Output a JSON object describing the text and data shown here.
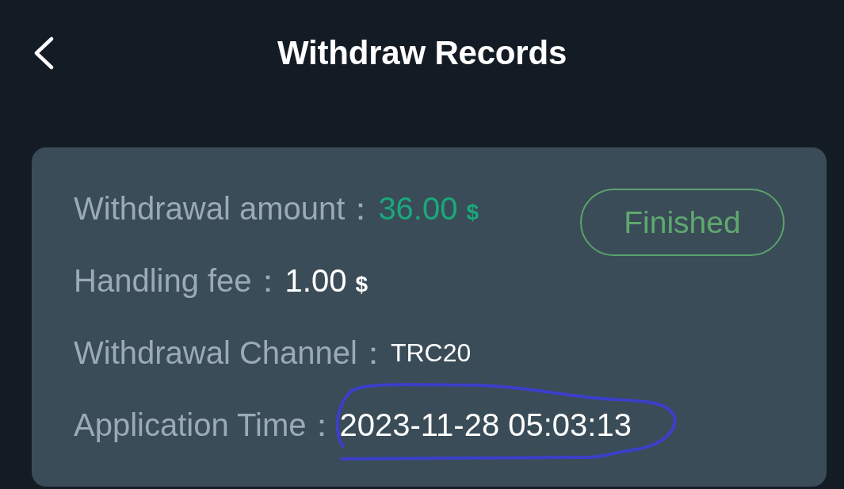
{
  "header": {
    "title": "Withdraw Records"
  },
  "record": {
    "status": "Finished",
    "fields": [
      {
        "kind": "amount",
        "label": "Withdrawal amount：",
        "value": "36.00",
        "unit": "$",
        "circled": false
      },
      {
        "kind": "fee",
        "label": "Handling fee：",
        "value": "1.00",
        "unit": "$",
        "circled": false
      },
      {
        "kind": "channel",
        "label": "Withdrawal Channel：",
        "value": "TRC20",
        "circled": false
      },
      {
        "kind": "time",
        "label": "Application Time：",
        "value": "2023-11-28 05:03:13",
        "circled": true
      }
    ]
  }
}
